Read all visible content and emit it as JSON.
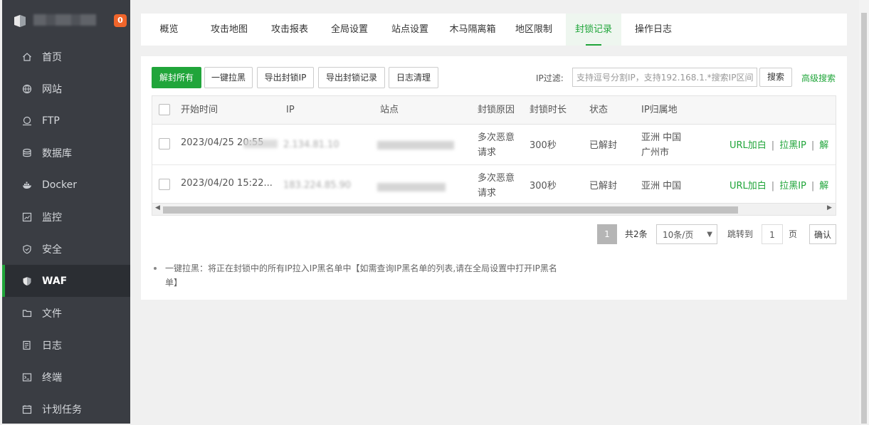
{
  "sidebar": {
    "badge": "0",
    "items": [
      {
        "label": "首页",
        "icon": "home-icon"
      },
      {
        "label": "网站",
        "icon": "globe-icon"
      },
      {
        "label": "FTP",
        "icon": "ftp-icon"
      },
      {
        "label": "数据库",
        "icon": "database-icon"
      },
      {
        "label": "Docker",
        "icon": "docker-icon"
      },
      {
        "label": "监控",
        "icon": "monitor-icon"
      },
      {
        "label": "安全",
        "icon": "shield-icon"
      },
      {
        "label": "WAF",
        "icon": "waf-shield-icon",
        "active": true
      },
      {
        "label": "文件",
        "icon": "folder-icon"
      },
      {
        "label": "日志",
        "icon": "log-icon"
      },
      {
        "label": "终端",
        "icon": "terminal-icon"
      },
      {
        "label": "计划任务",
        "icon": "calendar-icon"
      }
    ]
  },
  "tabs": [
    "概览",
    "攻击地图",
    "攻击报表",
    "全局设置",
    "站点设置",
    "木马隔离箱",
    "地区限制",
    "封锁记录",
    "操作日志"
  ],
  "toolbar": {
    "unblock_all": "解封所有",
    "blacklist_all": "一键拉黑",
    "export_ip": "导出封锁IP",
    "export_records": "导出封锁记录",
    "clear_log": "日志清理",
    "filter_label": "IP过滤:",
    "filter_placeholder": "支持逗号分割IP，支持192.168.1.*搜索IP区间",
    "search": "搜索",
    "advanced": "高级搜索"
  },
  "table": {
    "headers": [
      "开始时间",
      "IP",
      "站点",
      "封锁原因",
      "封锁时长",
      "状态",
      "IP归属地"
    ],
    "rows": [
      {
        "time": "2023/04/25 20:55",
        "ip": "2.134.81.10",
        "reason_1": "多次恶意",
        "reason_2": "请求",
        "duration": "300秒",
        "status": "已解封",
        "loc_1": "亚洲 中国",
        "loc_2": "广州市"
      },
      {
        "time": "2023/04/20 15:22...",
        "ip": "183.224.85.90",
        "reason_1": "多次恶意",
        "reason_2": "请求",
        "duration": "300秒",
        "status": "已解封",
        "loc_1": "亚洲 中国",
        "loc_2": ""
      }
    ],
    "actions": {
      "url_whitelist": "URL加白",
      "block_ip": "拉黑IP",
      "unblock": "解"
    }
  },
  "pagination": {
    "current": "1",
    "total": "共2条",
    "page_size": "10条/页",
    "jump_label": "跳转到",
    "jump_value": "1",
    "page_label": "页",
    "confirm": "确认"
  },
  "note": "一键拉黑：将正在封锁中的所有IP拉入IP黑名单中【如需查询IP黑名单的列表,请在全局设置中打开IP黑名单】",
  "colors": {
    "accent": "#20a53a",
    "sidebar_bg": "#3a3d43",
    "badge": "#f0652b"
  }
}
